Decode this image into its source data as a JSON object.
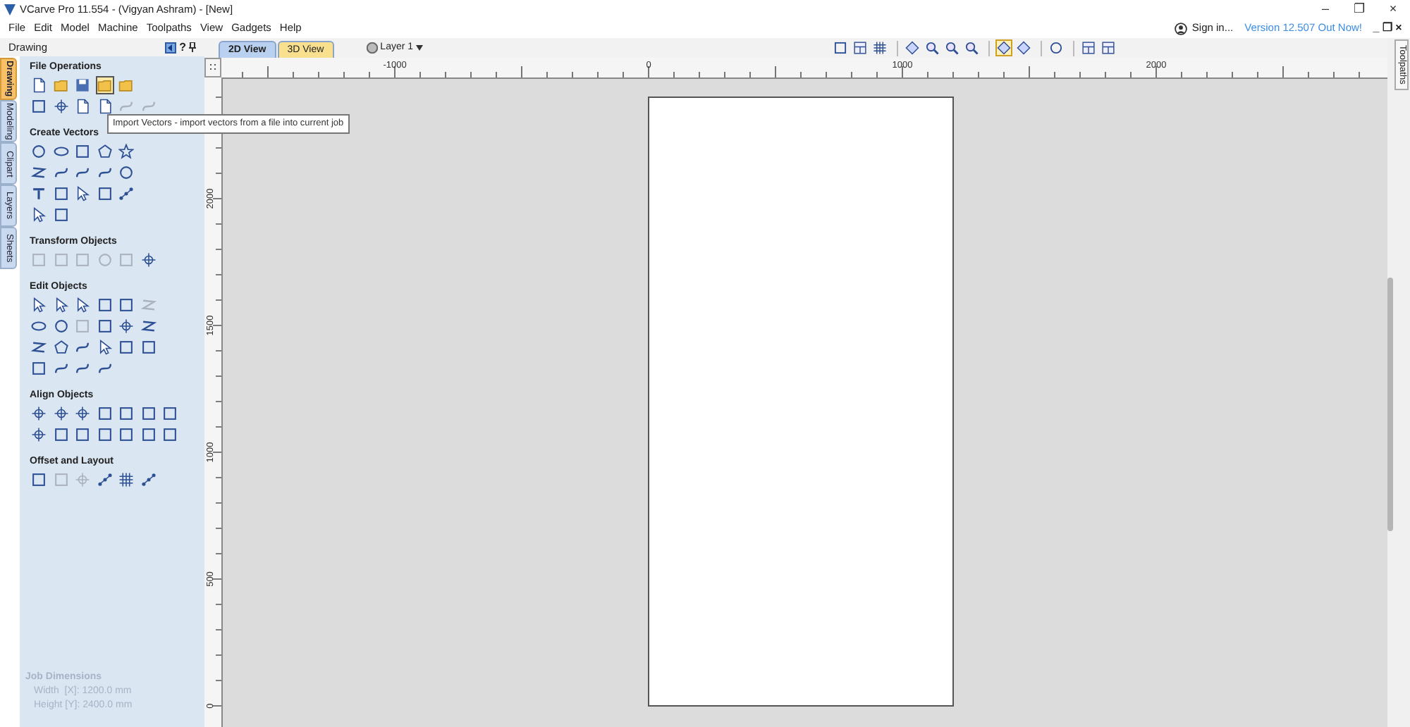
{
  "window": {
    "title": "VCarve Pro 11.554 - (Vigyan Ashram) - [New]",
    "controls": [
      "–",
      "❐",
      "×"
    ]
  },
  "menu": [
    "File",
    "Edit",
    "Model",
    "Machine",
    "Toolpaths",
    "View",
    "Gadgets",
    "Help"
  ],
  "account": {
    "sign_in": "Sign in...",
    "update_link": "Version 12.507 Out Now!",
    "doc_controls": [
      "_",
      "❐",
      "×"
    ]
  },
  "panel": {
    "title": "Drawing",
    "help": "?",
    "side_tabs": [
      {
        "label": "Drawing",
        "selected": true
      },
      {
        "label": "Modeling",
        "selected": false
      },
      {
        "label": "Clipart",
        "selected": false
      },
      {
        "label": "Layers",
        "selected": false
      },
      {
        "label": "Sheets",
        "selected": false
      }
    ],
    "groups": [
      {
        "title": "File Operations",
        "rows": [
          [
            {
              "kind": "doc",
              "disabled": false,
              "hovered": false
            },
            {
              "kind": "folder",
              "disabled": false,
              "hovered": false
            },
            {
              "kind": "disk",
              "disabled": false,
              "hovered": false
            },
            {
              "kind": "folder",
              "disabled": false,
              "hovered": true
            },
            {
              "kind": "folder",
              "disabled": false,
              "hovered": false
            }
          ],
          [
            {
              "kind": "square",
              "disabled": false,
              "hovered": false
            },
            {
              "kind": "cross",
              "disabled": false,
              "hovered": false
            },
            {
              "kind": "doc",
              "disabled": false,
              "hovered": false
            },
            {
              "kind": "doc",
              "disabled": false,
              "hovered": false
            },
            {
              "kind": "curve",
              "disabled": true,
              "hovered": false
            },
            {
              "kind": "curve",
              "disabled": true,
              "hovered": false
            }
          ]
        ]
      },
      {
        "title": "Create Vectors",
        "rows": [
          [
            {
              "kind": "circle",
              "disabled": false,
              "hovered": false
            },
            {
              "kind": "ellipse",
              "disabled": false,
              "hovered": false
            },
            {
              "kind": "square",
              "disabled": false,
              "hovered": false
            },
            {
              "kind": "polygon",
              "disabled": false,
              "hovered": false
            },
            {
              "kind": "star",
              "disabled": false,
              "hovered": false
            }
          ],
          [
            {
              "kind": "line",
              "disabled": false,
              "hovered": false
            },
            {
              "kind": "curve",
              "disabled": false,
              "hovered": false
            },
            {
              "kind": "curve",
              "disabled": false,
              "hovered": false
            },
            {
              "kind": "curve",
              "disabled": false,
              "hovered": false
            },
            {
              "kind": "circle",
              "disabled": false,
              "hovered": false
            }
          ],
          [
            {
              "kind": "bars",
              "disabled": false,
              "hovered": false
            },
            {
              "kind": "square",
              "disabled": false,
              "hovered": false
            },
            {
              "kind": "arrow",
              "disabled": false,
              "hovered": false
            },
            {
              "kind": "square",
              "disabled": false,
              "hovered": false
            },
            {
              "kind": "dots",
              "disabled": false,
              "hovered": false
            }
          ],
          [
            {
              "kind": "arrow",
              "disabled": false,
              "hovered": false
            },
            {
              "kind": "square",
              "disabled": false,
              "hovered": false
            }
          ]
        ]
      },
      {
        "title": "Transform Objects",
        "rows": [
          [
            {
              "kind": "square",
              "disabled": true,
              "hovered": false
            },
            {
              "kind": "square",
              "disabled": true,
              "hovered": false
            },
            {
              "kind": "square",
              "disabled": true,
              "hovered": false
            },
            {
              "kind": "circle",
              "disabled": true,
              "hovered": false
            },
            {
              "kind": "square",
              "disabled": true,
              "hovered": false
            },
            {
              "kind": "cross",
              "disabled": false,
              "hovered": false
            }
          ]
        ]
      },
      {
        "title": "Edit Objects",
        "rows": [
          [
            {
              "kind": "arrow",
              "disabled": false,
              "hovered": false
            },
            {
              "kind": "arrow",
              "disabled": false,
              "hovered": false
            },
            {
              "kind": "arrow",
              "disabled": false,
              "hovered": false
            },
            {
              "kind": "square",
              "disabled": false,
              "hovered": false
            },
            {
              "kind": "square",
              "disabled": false,
              "hovered": false
            },
            {
              "kind": "line",
              "disabled": true,
              "hovered": false
            }
          ],
          [
            {
              "kind": "ellipse",
              "disabled": false,
              "hovered": false
            },
            {
              "kind": "circle",
              "disabled": false,
              "hovered": false
            },
            {
              "kind": "square",
              "disabled": true,
              "hovered": false
            },
            {
              "kind": "square",
              "disabled": false,
              "hovered": false
            },
            {
              "kind": "cross",
              "disabled": false,
              "hovered": false
            },
            {
              "kind": "line",
              "disabled": false,
              "hovered": false
            }
          ],
          [
            {
              "kind": "line",
              "disabled": false,
              "hovered": false
            },
            {
              "kind": "polygon",
              "disabled": false,
              "hovered": false
            },
            {
              "kind": "curve",
              "disabled": false,
              "hovered": false
            },
            {
              "kind": "arrow",
              "disabled": false,
              "hovered": false
            },
            {
              "kind": "square",
              "disabled": false,
              "hovered": false
            },
            {
              "kind": "square",
              "disabled": false,
              "hovered": false
            }
          ],
          [
            {
              "kind": "square",
              "disabled": false,
              "hovered": false
            },
            {
              "kind": "curve",
              "disabled": false,
              "hovered": false
            },
            {
              "kind": "curve",
              "disabled": false,
              "hovered": false
            },
            {
              "kind": "curve",
              "disabled": false,
              "hovered": false
            }
          ]
        ]
      },
      {
        "title": "Align Objects",
        "rows": [
          [
            {
              "kind": "cross",
              "disabled": false,
              "hovered": false
            },
            {
              "kind": "cross",
              "disabled": false,
              "hovered": false
            },
            {
              "kind": "cross",
              "disabled": false,
              "hovered": false
            },
            {
              "kind": "square",
              "disabled": false,
              "hovered": false
            },
            {
              "kind": "square",
              "disabled": false,
              "hovered": false
            },
            {
              "kind": "square",
              "disabled": false,
              "hovered": false
            },
            {
              "kind": "square",
              "disabled": false,
              "hovered": false
            }
          ],
          [
            {
              "kind": "cross",
              "disabled": false,
              "hovered": false
            },
            {
              "kind": "square",
              "disabled": false,
              "hovered": false
            },
            {
              "kind": "square",
              "disabled": false,
              "hovered": false
            },
            {
              "kind": "square",
              "disabled": false,
              "hovered": false
            },
            {
              "kind": "square",
              "disabled": false,
              "hovered": false
            },
            {
              "kind": "square",
              "disabled": false,
              "hovered": false
            },
            {
              "kind": "square",
              "disabled": false,
              "hovered": false
            }
          ]
        ]
      },
      {
        "title": "Offset and Layout",
        "rows": [
          [
            {
              "kind": "square",
              "disabled": false,
              "hovered": false
            },
            {
              "kind": "square",
              "disabled": true,
              "hovered": false
            },
            {
              "kind": "cross",
              "disabled": true,
              "hovered": false
            },
            {
              "kind": "dots",
              "disabled": false,
              "hovered": false
            },
            {
              "kind": "grid",
              "disabled": false,
              "hovered": false
            },
            {
              "kind": "dots",
              "disabled": false,
              "hovered": false
            }
          ]
        ]
      }
    ],
    "job": {
      "title": "Job Dimensions",
      "lines": [
        "Width  [X]: 1200.0 mm",
        "Height [Y]: 2400.0 mm"
      ]
    }
  },
  "tooltip": "Import Vectors - import vectors from a file into current job",
  "view_tabs": [
    {
      "label": "2D View",
      "selected": true
    },
    {
      "label": "3D View",
      "selected": false
    }
  ],
  "layer": {
    "label": "Layer 1"
  },
  "view_toolbar": [
    [
      {
        "kind": "square",
        "selected": false
      },
      {
        "kind": "split",
        "selected": false
      },
      {
        "kind": "grid",
        "selected": false
      }
    ],
    [
      {
        "kind": "diamond",
        "selected": false
      },
      {
        "kind": "magnifier",
        "selected": false
      },
      {
        "kind": "magnifier",
        "selected": false
      },
      {
        "kind": "magnifier",
        "selected": false
      }
    ],
    [
      {
        "kind": "diamond",
        "selected": true
      },
      {
        "kind": "diamond",
        "selected": false
      }
    ],
    [
      {
        "kind": "circle",
        "selected": false
      }
    ],
    [
      {
        "kind": "split",
        "selected": false
      },
      {
        "kind": "split",
        "selected": false
      }
    ]
  ],
  "rulers": {
    "x_labels": [
      "-1000",
      "0",
      "1000",
      "2000"
    ],
    "y_labels": [
      "2000",
      "1500",
      "1000",
      "500",
      "0"
    ]
  },
  "right_tabs": [
    {
      "label": "Toolpaths",
      "selected": false
    }
  ]
}
